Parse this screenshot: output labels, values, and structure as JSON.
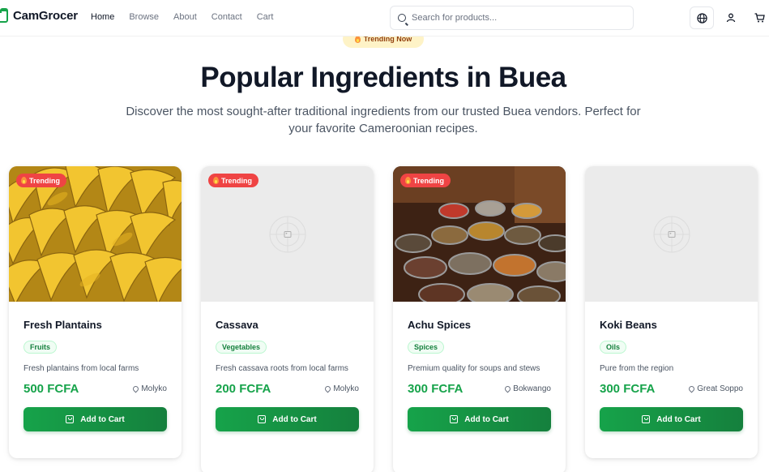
{
  "nav": {
    "brand": "CamGrocer",
    "links": [
      {
        "label": "Home",
        "active": true
      },
      {
        "label": "Browse",
        "active": false
      },
      {
        "label": "About",
        "active": false
      },
      {
        "label": "Contact",
        "active": false
      },
      {
        "label": "Cart",
        "active": false
      }
    ],
    "search_placeholder": "Search for products...",
    "icons": [
      "globe-icon",
      "user-icon",
      "cart-icon"
    ]
  },
  "hero": {
    "badge": "Trending Now",
    "title": "Popular Ingredients in Buea",
    "subtitle": "Discover the most sought-after traditional ingredients from our trusted Buea vendors. Perfect for your favorite Cameroonian recipes."
  },
  "colors": {
    "accent": "#16a34a",
    "trending_badge": "#ef4444",
    "hero_pill": "#fef3c7"
  },
  "products": [
    {
      "name": "Fresh Plantains",
      "category": "Fruits",
      "description": "Fresh plantains from local farms",
      "price": "500 FCFA",
      "location": "Molyko",
      "badge": "Trending",
      "button": "Add to Cart",
      "image": "bananas-photo"
    },
    {
      "name": "Cassava",
      "category": "Vegetables",
      "description": "Fresh cassava roots from local farms",
      "price": "200 FCFA",
      "location": "Molyko",
      "badge": "Trending",
      "button": "Add to Cart",
      "image": "placeholder"
    },
    {
      "name": "Achu Spices",
      "category": "Spices",
      "description": "Premium quality for soups and stews",
      "price": "300 FCFA",
      "location": "Bokwango",
      "badge": "Trending",
      "button": "Add to Cart",
      "image": "spice-bowls-photo"
    },
    {
      "name": "Koki Beans",
      "category": "Oils",
      "description": "Pure from the region",
      "price": "300 FCFA",
      "location": "Great Soppo",
      "badge": null,
      "button": "Add to Cart",
      "image": "placeholder"
    }
  ]
}
